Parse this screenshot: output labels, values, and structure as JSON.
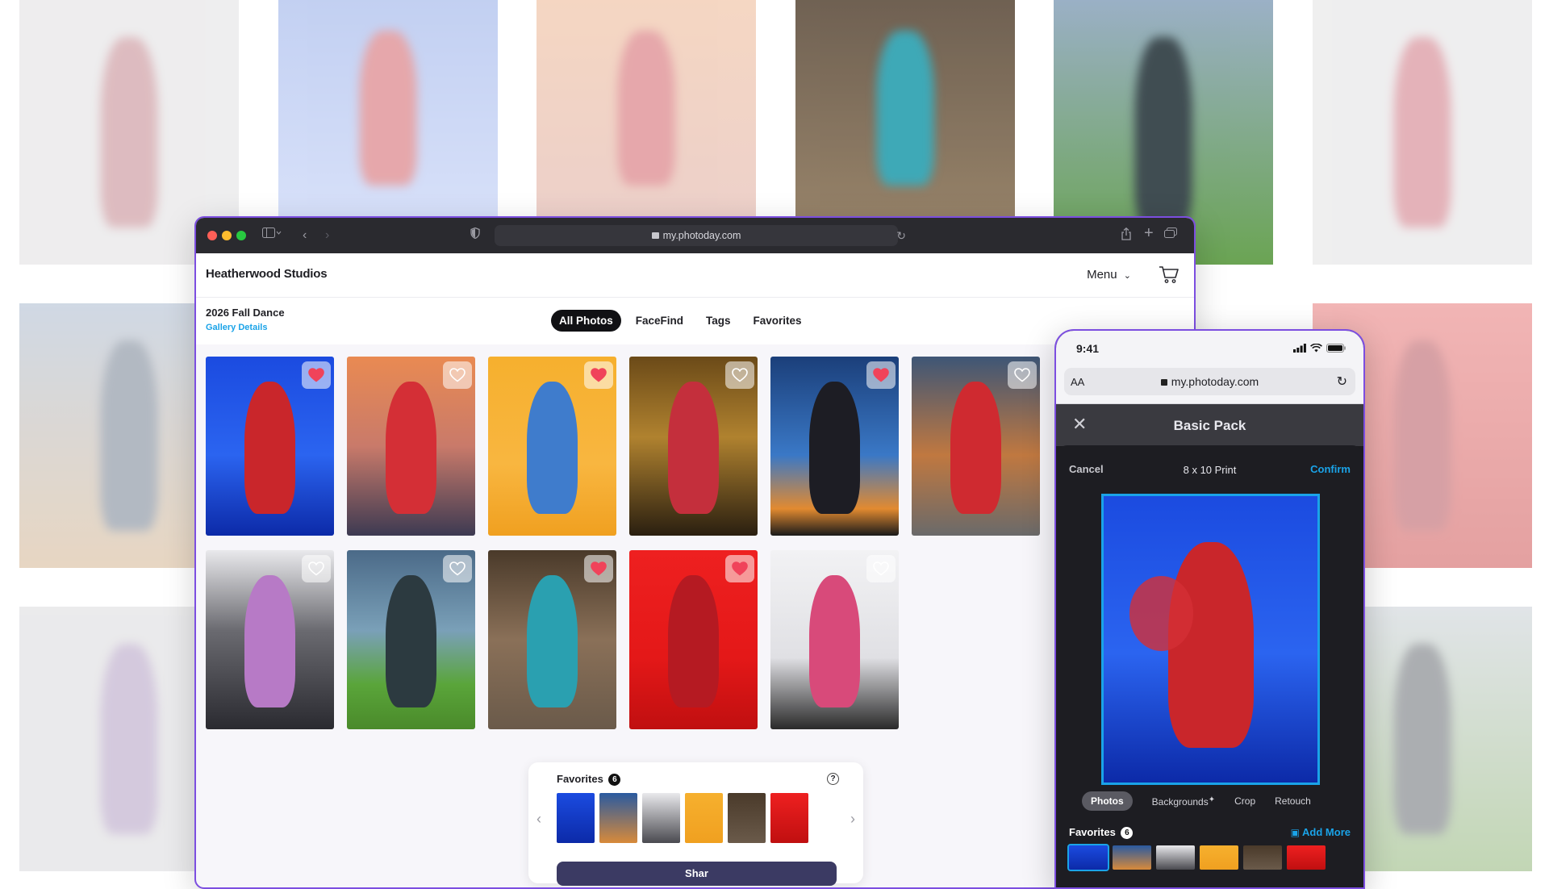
{
  "browser": {
    "url": "my.photoday.com",
    "brand": "Heatherwood Studios",
    "menu_label": "Menu",
    "event_title": "2026 Fall Dance",
    "gallery_details": "Gallery Details",
    "tabs": [
      {
        "label": "All Photos",
        "active": true
      },
      {
        "label": "FaceFind",
        "active": false
      },
      {
        "label": "Tags",
        "active": false
      },
      {
        "label": "Favorites",
        "active": false
      }
    ],
    "favorites_panel": {
      "title": "Favorites",
      "count": "6",
      "share_label": "Shar"
    }
  },
  "phone": {
    "time": "9:41",
    "aa": "AA",
    "url": "my.photoday.com",
    "modal_title": "Basic Pack",
    "cancel": "Cancel",
    "print_size": "8 x 10 Print",
    "confirm": "Confirm",
    "tools": [
      "Photos",
      "Backgrounds",
      "Crop",
      "Retouch"
    ],
    "favorites_label": "Favorites",
    "favorites_count": "6",
    "add_more": "Add More"
  },
  "colors": {
    "accent": "#1aa3e8",
    "window_border": "#7c4ee0",
    "heart_on": "#f0435a"
  },
  "photos": [
    {
      "bg": "linear-gradient(180deg,#1b4be0 0%,#2b64f0 55%,#0c2aa8 100%)",
      "fig": "#c9262b",
      "fav": true
    },
    {
      "bg": "linear-gradient(180deg,#e98a52 0%,#c97a6a 50%,#3d3a52 100%)",
      "fig": "#d42f36",
      "fav": false
    },
    {
      "bg": "linear-gradient(180deg,#f6b02e 0%,#f8b640 60%,#f0a020 100%)",
      "fig": "#3f7ccc",
      "fav": true
    },
    {
      "bg": "linear-gradient(180deg,#6b4a18 0%,#b0822f 45%,#2a1f10 100%)",
      "fig": "#c42f3c",
      "fav": false
    },
    {
      "bg": "linear-gradient(180deg,#1b3f7a 0%,#3a78c6 55%,#e28a30 85%,#1a1a1a 100%)",
      "fig": "#1d1d24",
      "fav": true
    },
    {
      "bg": "linear-gradient(180deg,#3e5676 0%,#c07840 55%,#6a6a6a 100%)",
      "fig": "#cf2a30",
      "fav": false
    },
    {
      "bg": "linear-gradient(180deg,#e9e9ec 0%,#6a6a70 45%,#2a2a30 100%)",
      "fig": "#b77ac6",
      "fav": false
    },
    {
      "bg": "linear-gradient(180deg,#4b6a88 0%,#7aa0b8 45%,#5aa53a 75%,#4a8a2a 100%)",
      "fig": "#2c3a40",
      "fav": false
    },
    {
      "bg": "linear-gradient(180deg,#4a3a2a 0%,#8a7058 50%,#6a5a4a 100%)",
      "fig": "#2aa0b0",
      "fav": true
    },
    {
      "bg": "linear-gradient(180deg,#ee2020 0%,#e41818 60%,#c00f10 100%)",
      "fig": "#b51a22",
      "fav": true
    },
    {
      "bg": "linear-gradient(180deg,#f2f2f4 0%,#e0e0e4 60%,#2a2a2a 100%)",
      "fig": "#d84a7a",
      "fav": false
    }
  ],
  "favorite_thumbs": [
    "linear-gradient(180deg,#1b4be0,#0c2aa8)",
    "linear-gradient(180deg,#2a5aa0,#d88a3a)",
    "linear-gradient(180deg,#e9e9ec,#4a4a50)",
    "linear-gradient(180deg,#f6b02e,#f0a020)",
    "linear-gradient(180deg,#4a3a2a,#6a5a4a)",
    "linear-gradient(180deg,#ee2020,#c00f10)"
  ]
}
